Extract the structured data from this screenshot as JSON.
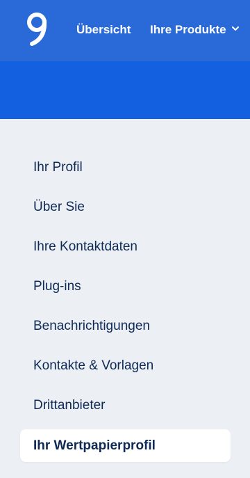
{
  "header": {
    "logo_icon": "brand-logo-icon",
    "nav": {
      "overview_label": "Übersicht",
      "products_label": "Ihre Produkte",
      "products_chevron_icon": "chevron-down-icon"
    }
  },
  "menu": {
    "items": [
      {
        "label": "Ihr Profil"
      },
      {
        "label": "Über Sie"
      },
      {
        "label": "Ihre Kontaktdaten"
      },
      {
        "label": "Plug-ins"
      },
      {
        "label": "Benachrichtigungen"
      },
      {
        "label": "Kontakte & Vorlagen"
      },
      {
        "label": "Drittanbieter"
      },
      {
        "label": "Ihr Wertpapierprofil",
        "active": true
      }
    ]
  },
  "colors": {
    "header_bg": "#2a69d8",
    "banner_bg": "#1361e0",
    "page_bg": "#eceff3",
    "text_primary": "#0e2a55",
    "white": "#ffffff"
  }
}
